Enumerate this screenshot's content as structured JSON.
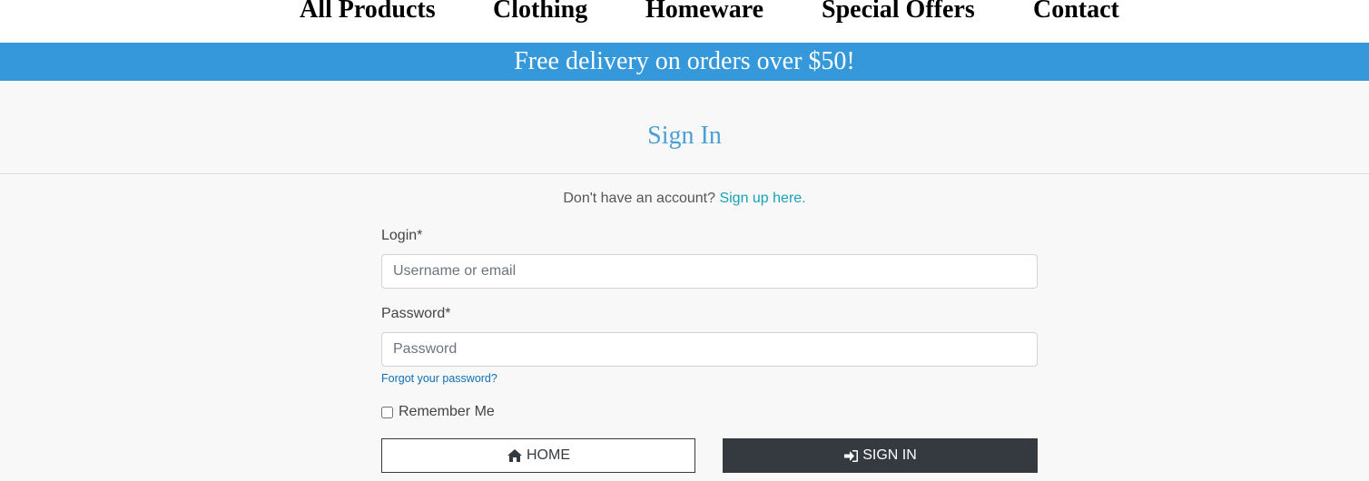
{
  "nav": {
    "items": [
      {
        "label": "All Products"
      },
      {
        "label": "Clothing"
      },
      {
        "label": "Homeware"
      },
      {
        "label": "Special Offers"
      },
      {
        "label": "Contact"
      }
    ]
  },
  "banner": {
    "text": "Free delivery on orders over $50!",
    "color": "#3498db"
  },
  "page": {
    "title": "Sign In"
  },
  "signup": {
    "prompt": "Don't have an account?",
    "link_text": "Sign up here."
  },
  "form": {
    "login_label": "Login*",
    "login_placeholder": "Username or email",
    "login_value": "",
    "password_label": "Password*",
    "password_placeholder": "Password",
    "password_value": "",
    "forgot_text": "Forgot your password?",
    "remember_label": "Remember Me",
    "remember_checked": false
  },
  "buttons": {
    "home_label": "HOME",
    "home_icon": "home-icon",
    "signin_label": "SIGN IN",
    "signin_icon": "sign-in-icon",
    "signin_color": "#343a40"
  }
}
